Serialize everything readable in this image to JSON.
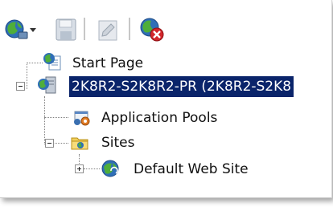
{
  "toolbar": {
    "items": [
      {
        "name": "connect-icon"
      },
      {
        "name": "dropdown-arrow-icon"
      },
      {
        "name": "save-icon"
      },
      {
        "name": "edit-icon"
      },
      {
        "name": "disconnect-icon"
      }
    ]
  },
  "tree": {
    "start_page": "Start Page",
    "server": "2K8R2-S2K8R2-PR (2K8R2-S2K8",
    "app_pools": "Application Pools",
    "sites": "Sites",
    "default_site": "Default Web Site"
  },
  "colors": {
    "selection": "#0a246a"
  }
}
